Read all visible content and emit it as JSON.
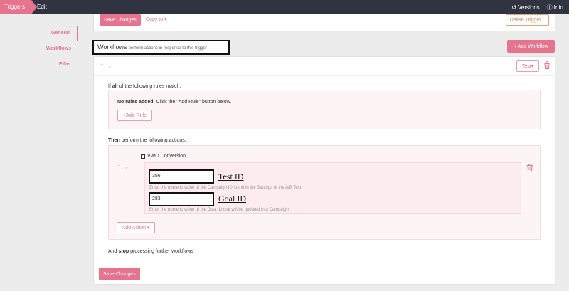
{
  "topbar": {
    "crumb_main": "Triggers",
    "crumb_edit": "Edit",
    "versions": "Versions",
    "info": "Info"
  },
  "sidebar": {
    "items": [
      {
        "label": "General"
      },
      {
        "label": "Workflows"
      },
      {
        "label": "Filter"
      }
    ]
  },
  "top_panel": {
    "save_label": "Save Changes",
    "copy_to_label": "Copy to",
    "delete_label": "Delete Trigger..."
  },
  "workflows": {
    "title": "Workflows",
    "subtitle": "perform actions in response to this trigger",
    "add_label": "Add Workflow",
    "test_label": "Test",
    "rules_prefix": "If ",
    "rules_bold": "all",
    "rules_suffix": " of the following rules match:",
    "no_rules_bold": "No rules added.",
    "no_rules_text": " Click the \"Add Rule\" button below.",
    "add_rule_label": "Add Rule",
    "actions_bold": "Then",
    "actions_suffix": " perform the following actions:",
    "action_name": "VWO Conversion",
    "fields": [
      {
        "value": "356",
        "label": "Test ID",
        "help": "Enter the numeric value of the Campaign ID found in the Settings of the A/B Test"
      },
      {
        "value": "283",
        "label": "Goal ID",
        "help": "Enter the numeric value of the Goal ID that will be updated in a Campaign"
      }
    ],
    "add_action_label": "Add Action",
    "stop_prefix": "And ",
    "stop_bold": "stop",
    "stop_suffix": " processing further workflows",
    "save_label": "Save Changes"
  },
  "colors": {
    "brand_pink": "#e7748f",
    "topbar": "#2f3440",
    "delete_orange": "#d9845a"
  }
}
